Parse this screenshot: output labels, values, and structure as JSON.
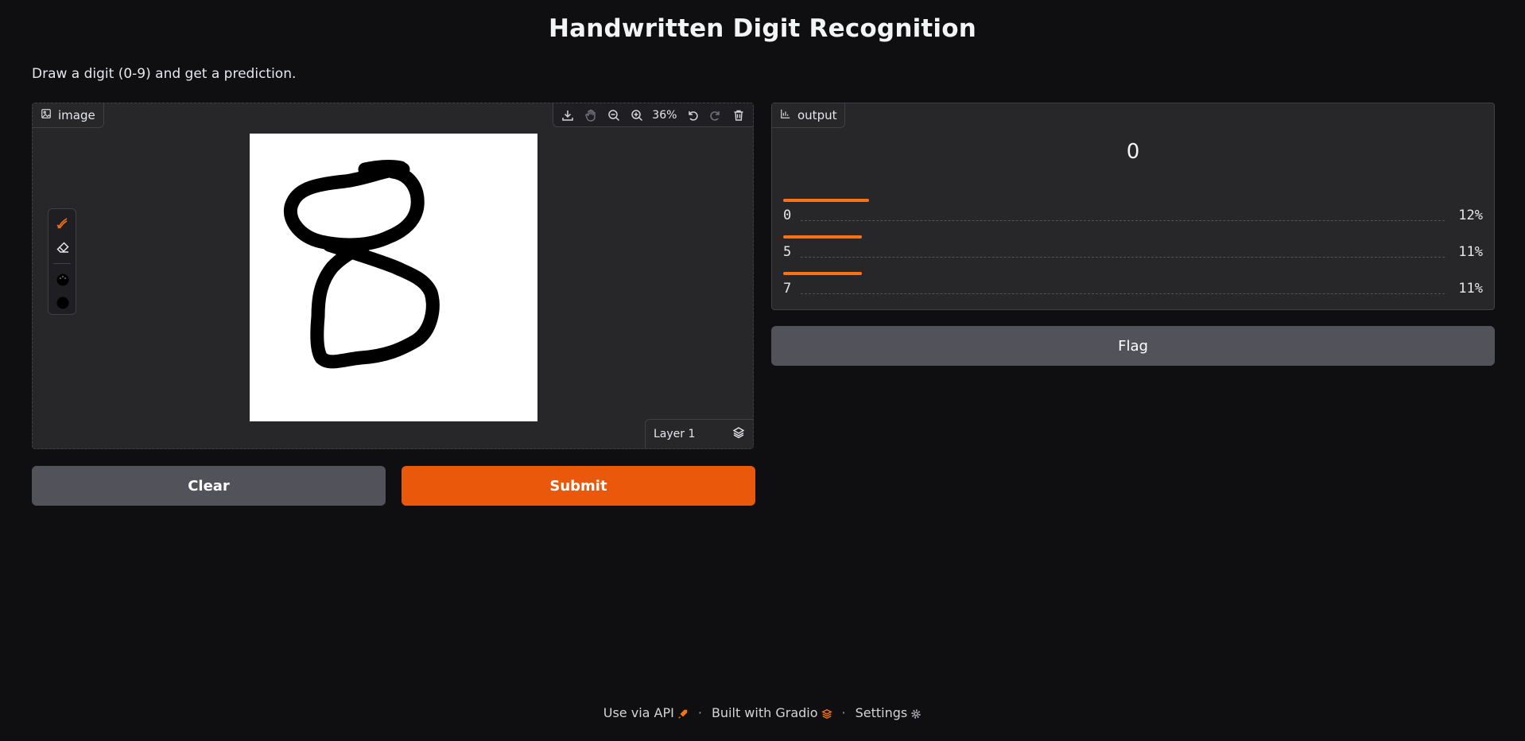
{
  "header": {
    "title": "Handwritten Digit Recognition",
    "description": "Draw a digit (0-9) and get a prediction."
  },
  "input_panel": {
    "label": "image",
    "zoom": "36%",
    "layer": "Layer 1",
    "toolbar_icons": [
      "download-icon",
      "pan-hand-icon",
      "zoom-out-icon",
      "zoom-in-icon",
      "undo-icon",
      "redo-icon",
      "trash-icon"
    ],
    "tools": [
      "brush-icon",
      "eraser-icon",
      "palette-icon",
      "brush-size-icon"
    ]
  },
  "buttons": {
    "clear": "Clear",
    "submit": "Submit",
    "flag": "Flag"
  },
  "output_panel": {
    "label": "output",
    "top_prediction": "0",
    "confidences": [
      {
        "label": "0",
        "value": 0.12,
        "text": "12%"
      },
      {
        "label": "5",
        "value": 0.11,
        "text": "11%"
      },
      {
        "label": "7",
        "value": 0.11,
        "text": "11%"
      }
    ]
  },
  "footer": {
    "api": "Use via API",
    "built": "Built with Gradio",
    "settings": "Settings"
  },
  "colors": {
    "accent": "#ea580c",
    "background": "#0f0f11",
    "panel": "#27272a"
  }
}
